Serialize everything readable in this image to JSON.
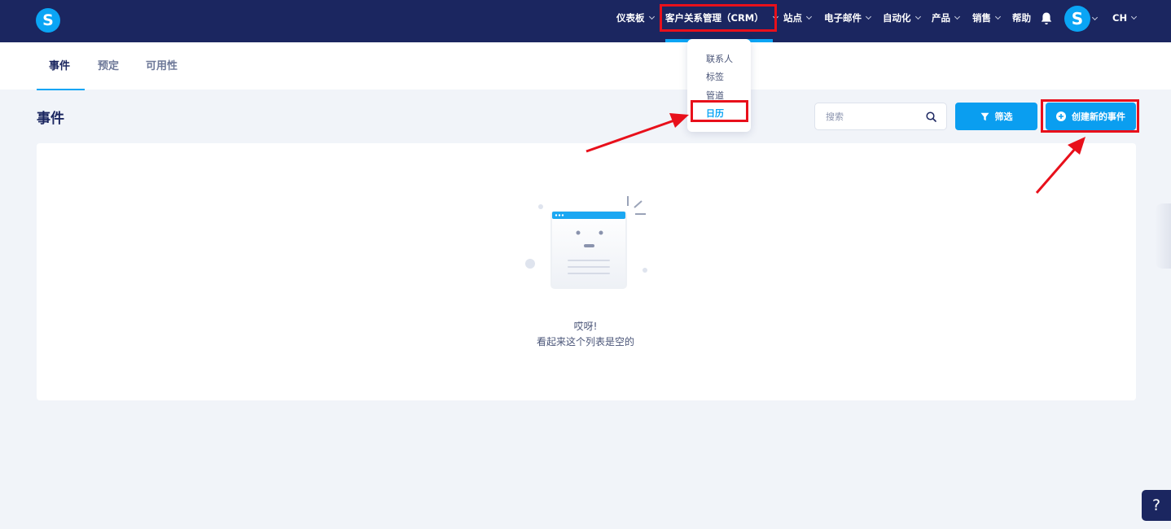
{
  "app": {
    "logo_letter": "S",
    "avatar_letter": "S"
  },
  "nav": {
    "items": [
      {
        "label": "仪表板"
      },
      {
        "label": "客户关系管理（CRM）"
      },
      {
        "label": "站点"
      },
      {
        "label": "电子邮件"
      },
      {
        "label": "自动化"
      },
      {
        "label": "产品"
      },
      {
        "label": "销售"
      },
      {
        "label": "帮助"
      }
    ],
    "language": "CH"
  },
  "crm_menu": {
    "items": [
      {
        "label": "联系人"
      },
      {
        "label": "标签"
      },
      {
        "label": "管道"
      },
      {
        "label": "日历"
      }
    ]
  },
  "tabs": [
    {
      "label": "事件",
      "active": true
    },
    {
      "label": "预定",
      "active": false
    },
    {
      "label": "可用性",
      "active": false
    }
  ],
  "page": {
    "title": "事件",
    "search_placeholder": "搜索",
    "filter_label": "筛选",
    "create_label": "创建新的事件"
  },
  "empty_state": {
    "title": "哎呀!",
    "subtitle": "看起来这个列表是空的"
  },
  "help": {
    "label": "?"
  },
  "colors": {
    "nav_bg": "#1b2660",
    "accent": "#0aa5f5",
    "button": "#0a9ef0",
    "highlight": "#e8101b",
    "page_bg": "#f1f4f9"
  }
}
